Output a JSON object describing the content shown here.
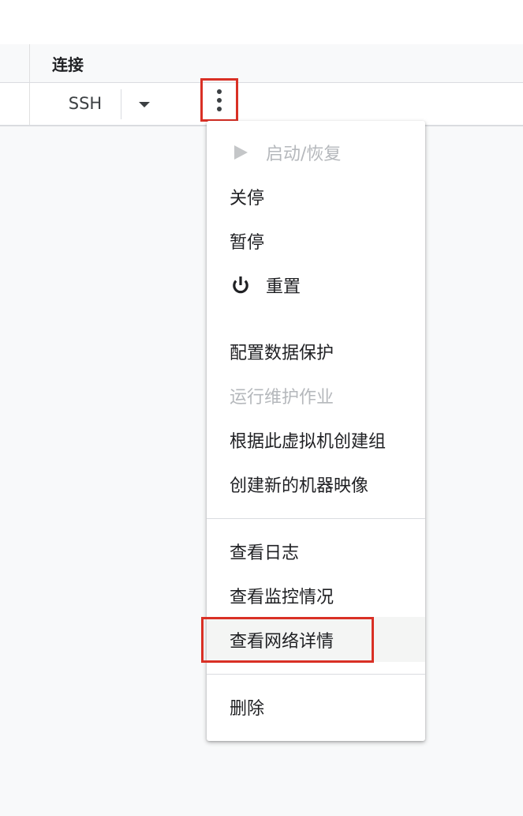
{
  "table": {
    "header": {
      "connect_label": "连接"
    },
    "row": {
      "ssh_label": "SSH"
    }
  },
  "icons": {
    "more": "more-vert-icon",
    "dropdown": "arrow-drop-down-icon",
    "start": "play-icon",
    "reset": "power-icon"
  },
  "menu": {
    "items": [
      {
        "label": "启动/恢复",
        "icon": "play-icon",
        "disabled": true
      },
      {
        "label": "关停",
        "disabled": false
      },
      {
        "label": "暂停",
        "disabled": false
      },
      {
        "label": "重置",
        "icon": "power-icon",
        "disabled": false
      },
      {
        "label": "配置数据保护",
        "disabled": false
      },
      {
        "label": "运行维护作业",
        "disabled": true
      },
      {
        "label": "根据此虚拟机创建组",
        "disabled": false
      },
      {
        "label": "创建新的机器映像",
        "disabled": false
      },
      {
        "label": "查看日志",
        "disabled": false
      },
      {
        "label": "查看监控情况",
        "disabled": false
      },
      {
        "label": "查看网络详情",
        "disabled": false,
        "highlighted": true
      },
      {
        "label": "删除",
        "disabled": false
      }
    ]
  },
  "colors": {
    "highlight_border": "#d93025",
    "disabled_text": "#b5b8bc",
    "text": "#202124",
    "divider": "#dadce0"
  }
}
